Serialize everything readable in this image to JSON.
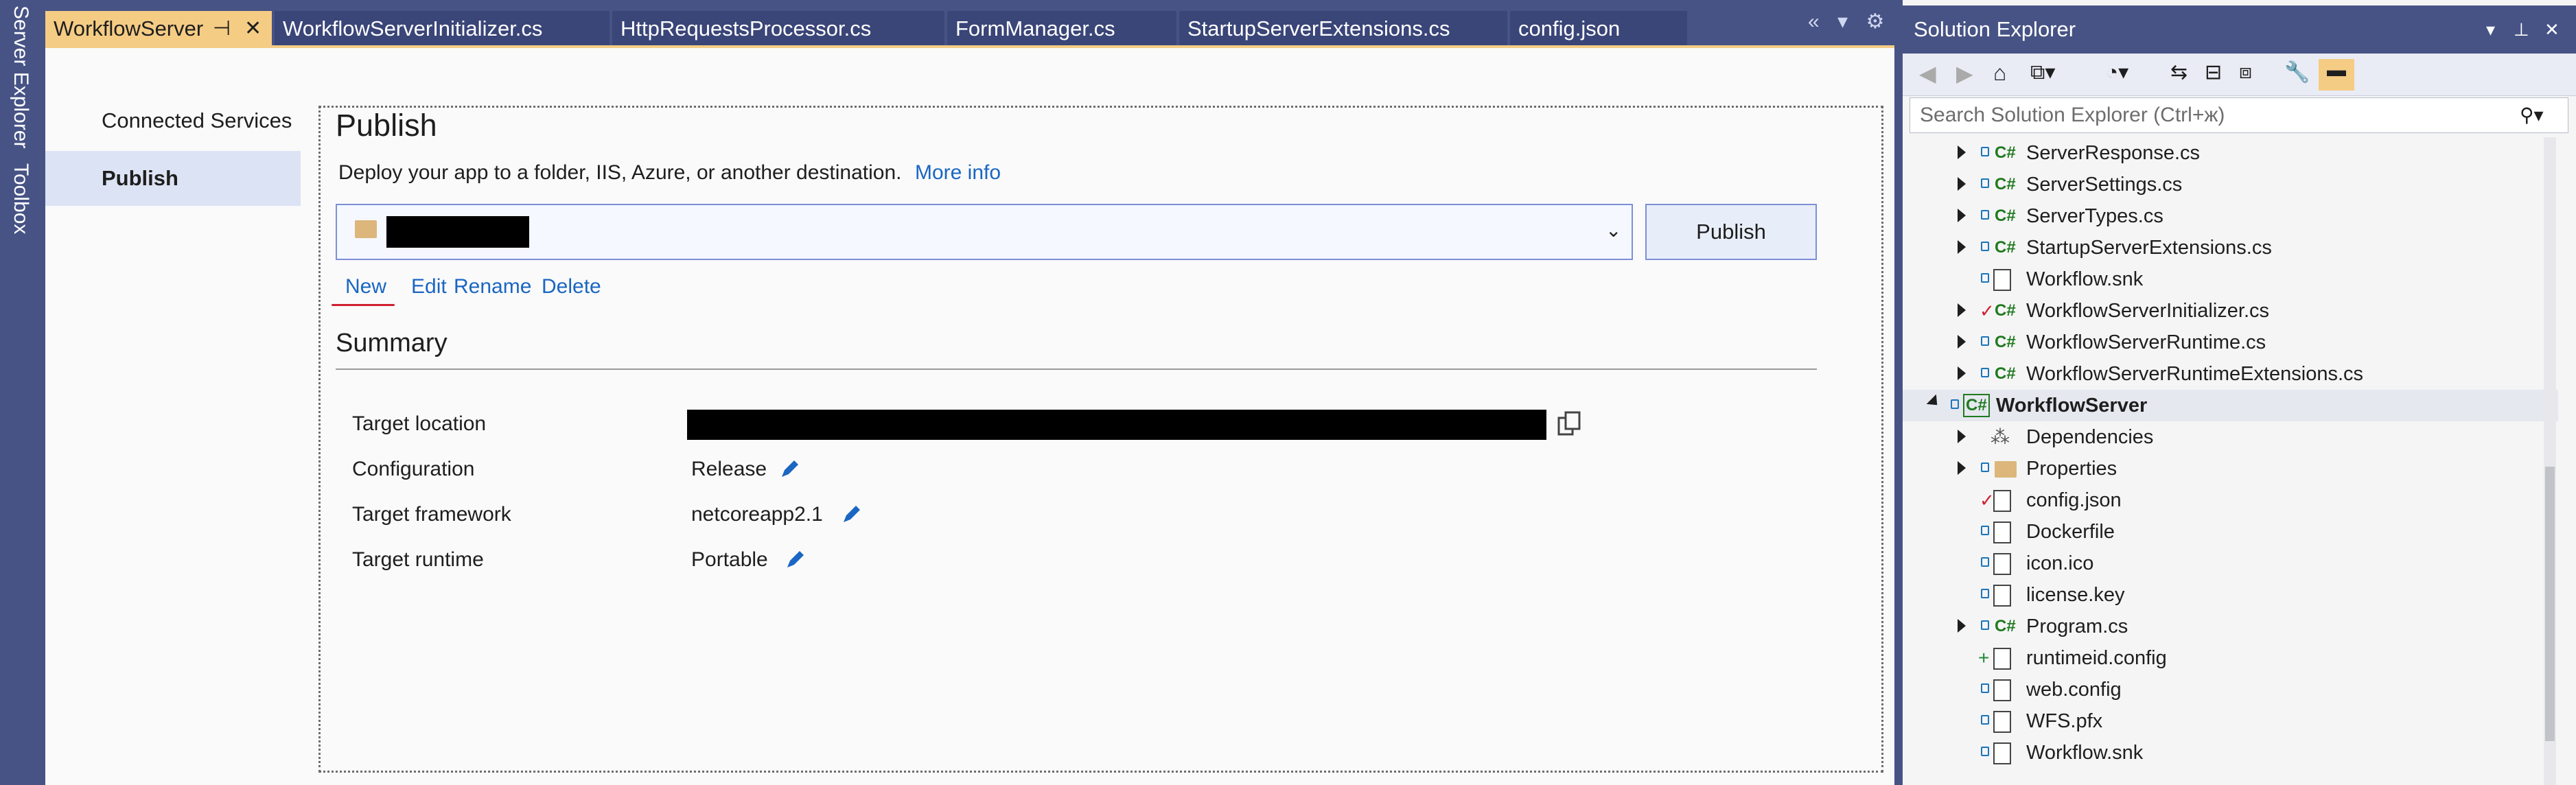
{
  "side_strip": {
    "server_explorer": "Server Explorer",
    "toolbox": "Toolbox"
  },
  "tabs": [
    {
      "label": "WorkflowServer",
      "active": true
    },
    {
      "label": "WorkflowServerInitializer.cs",
      "active": false
    },
    {
      "label": "HttpRequestsProcessor.cs",
      "active": false
    },
    {
      "label": "FormManager.cs",
      "active": false
    },
    {
      "label": "StartupServerExtensions.cs",
      "active": false
    },
    {
      "label": "config.json",
      "active": false
    }
  ],
  "left_nav": {
    "connected_services": "Connected Services",
    "publish": "Publish"
  },
  "publish": {
    "title": "Publish",
    "description": "Deploy your app to a folder, IIS, Azure, or another destination.",
    "more_info": "More info",
    "publish_button": "Publish",
    "actions": {
      "new": "New",
      "edit": "Edit",
      "rename": "Rename",
      "delete": "Delete"
    },
    "summary_title": "Summary",
    "summary": {
      "target_location_label": "Target location",
      "configuration_label": "Configuration",
      "configuration_value": "Release",
      "target_framework_label": "Target framework",
      "target_framework_value": "netcoreapp2.1",
      "target_runtime_label": "Target runtime",
      "target_runtime_value": "Portable"
    }
  },
  "solution_explorer": {
    "title": "Solution Explorer",
    "search_placeholder": "Search Solution Explorer (Ctrl+ж)",
    "items": [
      {
        "label": "ServerResponse.cs",
        "type": "cs",
        "expandable": true
      },
      {
        "label": "ServerSettings.cs",
        "type": "cs",
        "expandable": true
      },
      {
        "label": "ServerTypes.cs",
        "type": "cs",
        "expandable": true
      },
      {
        "label": "StartupServerExtensions.cs",
        "type": "cs",
        "expandable": true
      },
      {
        "label": "Workflow.snk",
        "type": "snk",
        "expandable": false
      },
      {
        "label": "WorkflowServerInitializer.cs",
        "type": "cs",
        "expandable": true,
        "modified": true
      },
      {
        "label": "WorkflowServerRuntime.cs",
        "type": "cs",
        "expandable": true
      },
      {
        "label": "WorkflowServerRuntimeExtensions.cs",
        "type": "cs",
        "expandable": true
      },
      {
        "label": "WorkflowServer",
        "type": "project",
        "expandable": true,
        "expanded": true
      },
      {
        "label": "Dependencies",
        "type": "deps",
        "expandable": true
      },
      {
        "label": "Properties",
        "type": "folder",
        "expandable": true
      },
      {
        "label": "config.json",
        "type": "json",
        "expandable": false,
        "modified": true
      },
      {
        "label": "Dockerfile",
        "type": "file",
        "expandable": false
      },
      {
        "label": "icon.ico",
        "type": "ico",
        "expandable": false
      },
      {
        "label": "license.key",
        "type": "file",
        "expandable": false
      },
      {
        "label": "Program.cs",
        "type": "cs",
        "expandable": true
      },
      {
        "label": "runtimeid.config",
        "type": "config",
        "expandable": false,
        "added": true
      },
      {
        "label": "web.config",
        "type": "config",
        "expandable": false
      },
      {
        "label": "WFS.pfx",
        "type": "pfx",
        "expandable": false
      },
      {
        "label": "Workflow.snk",
        "type": "snk",
        "expandable": false
      }
    ]
  }
}
